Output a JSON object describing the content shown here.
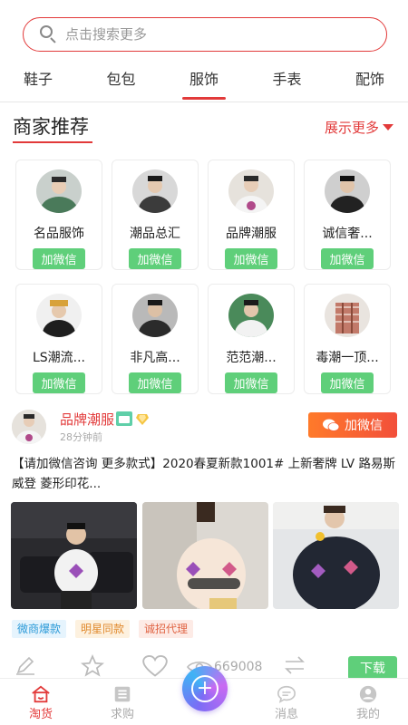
{
  "search": {
    "placeholder": "点击搜索更多"
  },
  "categories": [
    {
      "label": "鞋子",
      "active": false
    },
    {
      "label": "包包",
      "active": false
    },
    {
      "label": "服饰",
      "active": true
    },
    {
      "label": "手表",
      "active": false
    },
    {
      "label": "配饰",
      "active": false
    }
  ],
  "section": {
    "title": "商家推荐",
    "more_label": "展示更多"
  },
  "merchants": [
    {
      "name": "名品服饰",
      "button": "加微信"
    },
    {
      "name": "潮品总汇",
      "button": "加微信"
    },
    {
      "name": "品牌潮服",
      "button": "加微信"
    },
    {
      "name": "诚信奢...",
      "button": "加微信"
    },
    {
      "name": "LS潮流...",
      "button": "加微信"
    },
    {
      "name": "非凡高...",
      "button": "加微信"
    },
    {
      "name": "范范潮...",
      "button": "加微信"
    },
    {
      "name": "毒潮一顶...",
      "button": "加微信"
    }
  ],
  "post": {
    "shop_name": "品牌潮服",
    "time": "28分钟前",
    "wechat_button": "加微信",
    "text": "【请加微信咨询 更多款式】2020春夏新款1001# 上新奢牌 LV 路易斯威登 菱形印花...",
    "tags": [
      "微商爆款",
      "明星同款",
      "诚招代理"
    ],
    "views": "669008",
    "download_label": "下载"
  },
  "bottom_nav": {
    "items": [
      {
        "label": "淘货",
        "active": true
      },
      {
        "label": "求购",
        "active": false
      },
      {
        "label": "消息",
        "active": false
      },
      {
        "label": "我的",
        "active": false
      }
    ]
  },
  "colors": {
    "accent": "#e23a3a",
    "wechat_green": "#5fcf7a",
    "orange": "#ff7a2a"
  }
}
